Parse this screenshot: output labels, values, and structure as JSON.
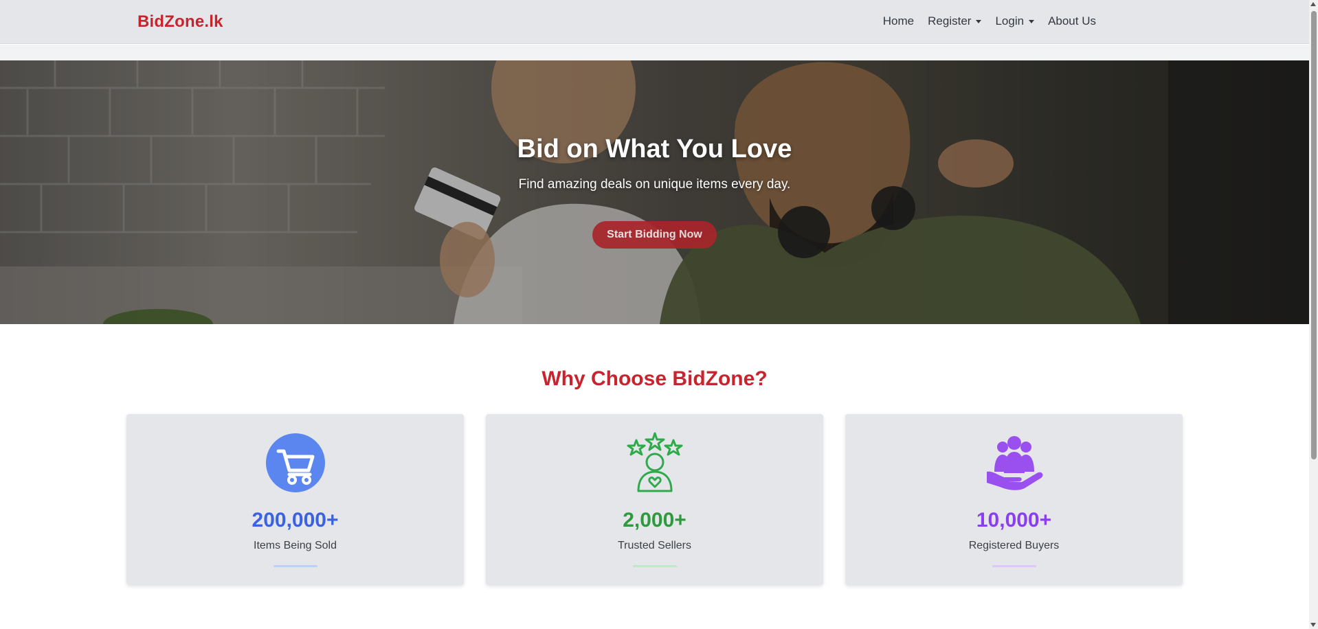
{
  "brand": {
    "name": "BidZone.lk",
    "color": "#c9232d"
  },
  "nav": {
    "items": [
      {
        "label": "Home",
        "dropdown": false
      },
      {
        "label": "Register",
        "dropdown": true
      },
      {
        "label": "Login",
        "dropdown": true
      },
      {
        "label": "About Us",
        "dropdown": false
      }
    ]
  },
  "hero": {
    "title": "Bid on What You Love",
    "subtitle": "Find amazing deals on unique items every day.",
    "cta_label": "Start Bidding Now",
    "cta_color": "#a8262b"
  },
  "features": {
    "title": "Why Choose BidZone?",
    "cards": [
      {
        "value": "200,000+",
        "label": "Items Being Sold",
        "icon": "shopping-cart-icon",
        "color": "#3b63e0",
        "accent": "#bcd0f5"
      },
      {
        "value": "2,000+",
        "label": "Trusted Sellers",
        "icon": "star-rated-seller-icon",
        "color": "#2e9a3e",
        "accent": "#bfe8c6"
      },
      {
        "value": "10,000+",
        "label": "Registered Buyers",
        "icon": "community-hand-icon",
        "color": "#8b3ef0",
        "accent": "#dcc8f6"
      }
    ]
  }
}
